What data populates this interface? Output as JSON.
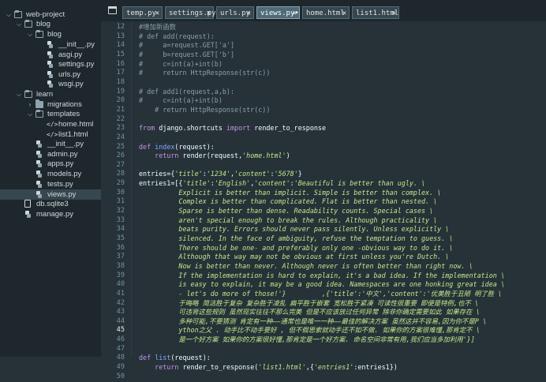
{
  "sidebar": {
    "items": [
      {
        "label": "web-project",
        "type": "folder-open",
        "depth": 0,
        "chevron": "down"
      },
      {
        "label": "blog",
        "type": "folder-open",
        "depth": 1,
        "chevron": "down"
      },
      {
        "label": "blog",
        "type": "folder-open",
        "depth": 2,
        "chevron": "down"
      },
      {
        "label": "__init__.py",
        "type": "py",
        "depth": 3
      },
      {
        "label": "asgi.py",
        "type": "py",
        "depth": 3
      },
      {
        "label": "settings.py",
        "type": "py",
        "depth": 3
      },
      {
        "label": "urls.py",
        "type": "py",
        "depth": 3
      },
      {
        "label": "wsgi.py",
        "type": "py",
        "depth": 3
      },
      {
        "label": "learn",
        "type": "folder-open",
        "depth": 1,
        "chevron": "down"
      },
      {
        "label": "migrations",
        "type": "folder",
        "depth": 2,
        "chevron": "right"
      },
      {
        "label": "templates",
        "type": "folder-open",
        "depth": 2,
        "chevron": "down"
      },
      {
        "label": "home.html",
        "type": "html",
        "depth": 3
      },
      {
        "label": "list1.html",
        "type": "html",
        "depth": 3
      },
      {
        "label": "__init__.py",
        "type": "py",
        "depth": 2
      },
      {
        "label": "admin.py",
        "type": "py",
        "depth": 2
      },
      {
        "label": "apps.py",
        "type": "py",
        "depth": 2
      },
      {
        "label": "models.py",
        "type": "py",
        "depth": 2
      },
      {
        "label": "tests.py",
        "type": "py",
        "depth": 2
      },
      {
        "label": "views.py",
        "type": "py",
        "depth": 2,
        "selected": true
      },
      {
        "label": "db.sqlite3",
        "type": "db",
        "depth": 1
      },
      {
        "label": "manage.py",
        "type": "py",
        "depth": 1
      }
    ]
  },
  "tabs": [
    {
      "label": "temp.py",
      "active": false
    },
    {
      "label": "settings.py",
      "active": false
    },
    {
      "label": "urls.py",
      "active": false
    },
    {
      "label": "views.py•",
      "active": true
    },
    {
      "label": "home.html",
      "active": false
    },
    {
      "label": "list1.html",
      "active": false
    }
  ],
  "editor": {
    "current_line": 45,
    "lines": [
      {
        "n": "12",
        "t": "#增加新函数"
      },
      {
        "n": "13",
        "t": "# def add(request):"
      },
      {
        "n": "14",
        "t": "#     a=request.GET['a']"
      },
      {
        "n": "15",
        "t": "#     b=request.GET['b']"
      },
      {
        "n": "16",
        "t": "#     c=int(a)+int(b)"
      },
      {
        "n": "17",
        "t": "#     return HttpResponse(str(c))"
      },
      {
        "n": "18",
        "t": ""
      },
      {
        "n": "19",
        "t": "# def add1(request,a,b):"
      },
      {
        "n": "20",
        "t": "#     c=int(a)+int(b)"
      },
      {
        "n": "21",
        "t": "    # return HttpResponse(str(c))"
      },
      {
        "n": "22",
        "t": ""
      },
      {
        "n": "23",
        "t": "from django.shortcuts import render_to_response"
      },
      {
        "n": "24",
        "t": ""
      },
      {
        "n": "25",
        "t": "def index(request):"
      },
      {
        "n": "26",
        "t": "    return render(request,'home.html')"
      },
      {
        "n": "27",
        "t": ""
      },
      {
        "n": "28",
        "t": "entries={'title':'1234','content':'5678'}"
      },
      {
        "n": "29",
        "t": "entries1=[{'title':'English','content':'Beautiful is better than ugly. \\"
      },
      {
        "n": "30",
        "t": "          Explicit is better than implicit. Simple is better than complex. \\"
      },
      {
        "n": "31",
        "t": "          Complex is better than complicated. Flat is better than nested. \\"
      },
      {
        "n": "32",
        "t": "          Sparse is better than dense. Readability counts. Special cases \\"
      },
      {
        "n": "33",
        "t": "          aren't special enough to break the rules. Although practicality \\"
      },
      {
        "n": "34",
        "t": "          beats purity. Errors should never pass silently. Unless explicitly \\"
      },
      {
        "n": "35",
        "t": "          silenced. In the face of ambiguity, refuse the temptation to guess. \\"
      },
      {
        "n": "36",
        "t": "          There should be one- and preferably only one -obvious way to do it. \\"
      },
      {
        "n": "37",
        "t": "          Although that way may not be obvious at first unless you're Dutch. \\"
      },
      {
        "n": "38",
        "t": "          Now is better than never. Although never is often better than right now. \\"
      },
      {
        "n": "39",
        "t": "          If the implementation is hard to explain, it's a bad idea. If the implementation \\"
      },
      {
        "n": "40",
        "t": "          is easy to explain, it may be a good idea. Namespaces are one honking great idea \\"
      },
      {
        "n": "41",
        "t": "          - let's do more of those!'}         ,{'title':'中文','content':'优美胜于丑陋 明了胜 \\"
      },
      {
        "n": "42",
        "t": "          于晦略 简洁胜于复杂 复杂胜于凌乱 扁平胜于嵌套 宽松胜于紧凑 可读性很重要 即便是特例,也不 \\"
      },
      {
        "n": "43",
        "t": "          可违背这些规则 虽然现实往往不那么完美 但是不应该放过任何异常 除非你确定需要如此 如果存在 \\"
      },
      {
        "n": "44",
        "t": "          多种可能,不要猜测 肯定有一种——通常也是唯一一种——最佳的解决方案 虽然这并不容易,因为你不是P \\"
      },
      {
        "n": "45",
        "t": "          ython之父 . 动手比不动手要好 , 但不假思索就动手还不如不做. 如果你的方案很难懂,那肯定不 \\"
      },
      {
        "n": "46",
        "t": "          是一个好方案 如果你的方案很好懂,那肯定是一个好方案. 命名空间非常有用,我们应当多加利用'}]"
      },
      {
        "n": "47",
        "t": ""
      },
      {
        "n": "48",
        "t": "def list(request):"
      },
      {
        "n": "49",
        "t": "    return render_to_response('list1.html',{'entries1':entries1})"
      },
      {
        "n": "50",
        "t": ""
      }
    ]
  },
  "colors": {
    "background": "#263238",
    "sidebar": "#1e272c",
    "keyword": "#c792ea",
    "function": "#82aaff",
    "string": "#c3e88d",
    "comment": "#8c9fa8"
  }
}
